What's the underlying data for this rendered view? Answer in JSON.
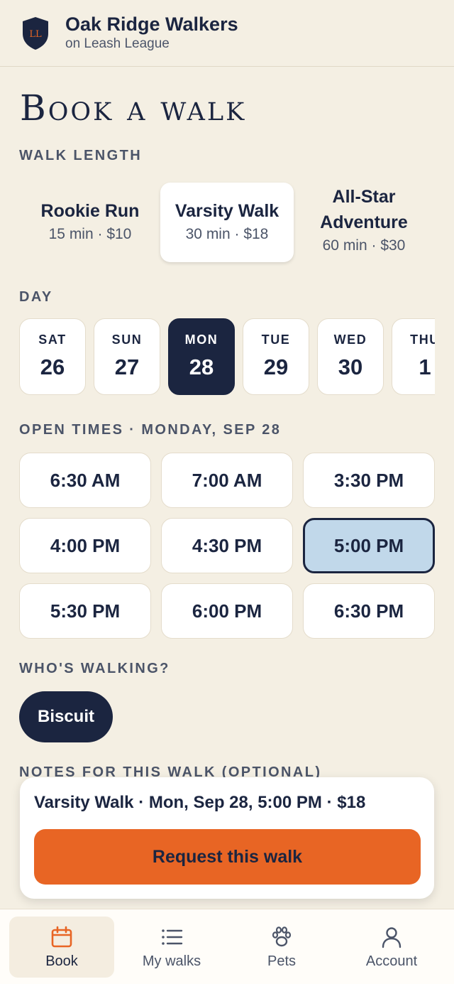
{
  "header": {
    "brand_title": "Oak Ridge Walkers",
    "brand_subtitle": "on Leash League",
    "logo_initials": "LL"
  },
  "page_title": "Book a walk",
  "walk_length": {
    "label": "WALK LENGTH",
    "options": [
      {
        "name": "Rookie Run",
        "meta": "15 min · $10",
        "selected": false
      },
      {
        "name": "Varsity Walk",
        "meta": "30 min · $18",
        "selected": true
      },
      {
        "name": "All-Star Adventure",
        "meta": "60 min · $30",
        "selected": false
      }
    ]
  },
  "day": {
    "label": "DAY",
    "options": [
      {
        "dow": "SAT",
        "num": "26",
        "selected": false
      },
      {
        "dow": "SUN",
        "num": "27",
        "selected": false
      },
      {
        "dow": "MON",
        "num": "28",
        "selected": true
      },
      {
        "dow": "TUE",
        "num": "29",
        "selected": false
      },
      {
        "dow": "WED",
        "num": "30",
        "selected": false
      },
      {
        "dow": "THU",
        "num": "1",
        "selected": false
      }
    ]
  },
  "open_times": {
    "label": "OPEN TIMES · MONDAY, SEP 28",
    "slots": [
      "6:30 AM",
      "7:00 AM",
      "3:30 PM",
      "4:00 PM",
      "4:30 PM",
      "5:00 PM",
      "5:30 PM",
      "6:00 PM",
      "6:30 PM"
    ],
    "selected": "5:00 PM"
  },
  "whos_walking": {
    "label": "WHO'S WALKING?",
    "pet": "Biscuit"
  },
  "notes": {
    "label": "NOTES FOR THIS WALK (OPTIONAL)"
  },
  "summary": {
    "text": "Varsity Walk · Mon, Sep 28, 5:00 PM · $18",
    "button_label": "Request this walk"
  },
  "bottom_nav": [
    {
      "label": "Book",
      "icon": "calendar-icon",
      "active": true
    },
    {
      "label": "My walks",
      "icon": "list-icon",
      "active": false
    },
    {
      "label": "Pets",
      "icon": "paw-icon",
      "active": false
    },
    {
      "label": "Account",
      "icon": "person-icon",
      "active": false
    }
  ],
  "colors": {
    "background": "#f4efe3",
    "navy": "#1b2540",
    "accent_orange": "#e86524",
    "selected_time": "#c1d8ea"
  }
}
